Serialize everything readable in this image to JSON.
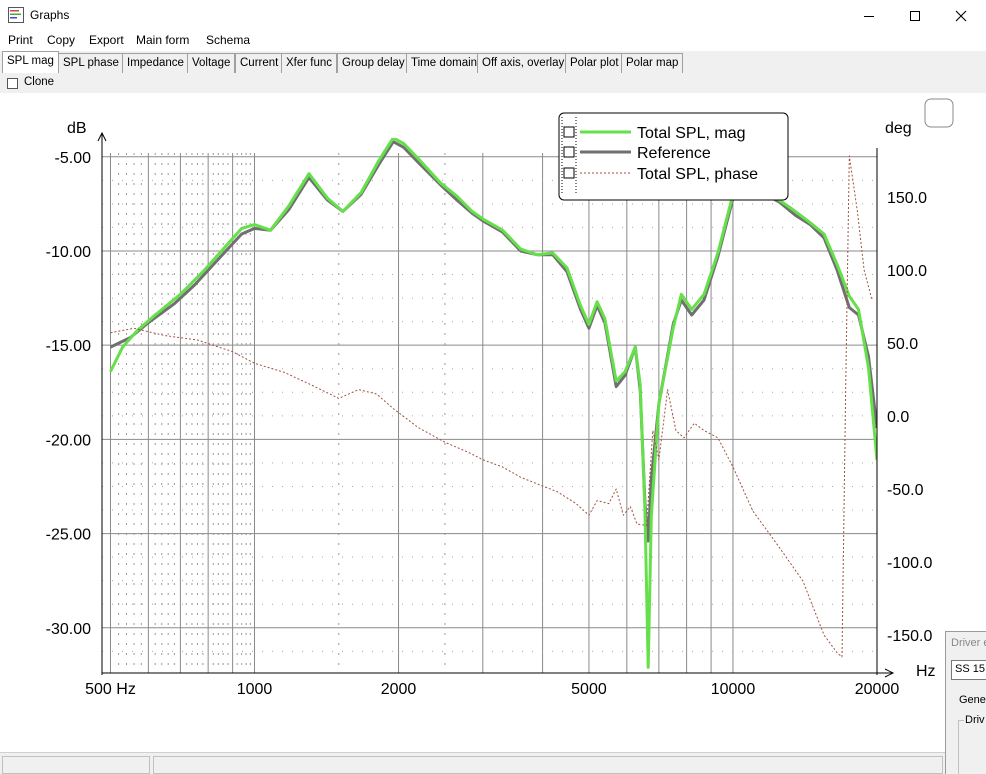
{
  "window": {
    "title": "Graphs"
  },
  "menu": [
    "Print",
    "Copy",
    "Export",
    "Main form",
    "Schema"
  ],
  "tabs": [
    "SPL mag",
    "SPL phase",
    "Impedance",
    "Voltage",
    "Current",
    "Xfer func",
    "Group delay",
    "Time domain",
    "Off axis, overlay",
    "Polar plot",
    "Polar map"
  ],
  "active_tab": "SPL mag",
  "options": {
    "clone_label": "Clone",
    "clone_checked": false
  },
  "driver_panel": {
    "title": "Driver e",
    "combo_value": "SS 15",
    "tab_label": "Gene",
    "group_label": "Driv"
  },
  "colors": {
    "total_spl": "#66e04a",
    "reference": "#707070",
    "phase": "#a0523d",
    "grid": "#8a8a8a"
  },
  "chart_data": {
    "type": "line",
    "ylabel": "dB",
    "y2label": "deg",
    "xunit": "Hz",
    "x_scale": "log",
    "xlim": [
      480,
      20000
    ],
    "ylim": [
      -32.4,
      -4.8
    ],
    "y2lim": [
      -176,
      180
    ],
    "x_ticks": [
      {
        "value": 500,
        "label": "500 Hz"
      },
      {
        "value": 1000,
        "label": "1000"
      },
      {
        "value": 2000,
        "label": "2000"
      },
      {
        "value": 5000,
        "label": "5000"
      },
      {
        "value": 10000,
        "label": "10000"
      },
      {
        "value": 20000,
        "label": "20000"
      }
    ],
    "x_gridlines": [
      500,
      600,
      700,
      800,
      900,
      1000,
      2000,
      3000,
      4000,
      5000,
      6000,
      7000,
      8000,
      9000,
      10000,
      20000
    ],
    "y_ticks": [
      {
        "value": -5,
        "label": "-5.00"
      },
      {
        "value": -10,
        "label": "-10.00"
      },
      {
        "value": -15,
        "label": "-15.00"
      },
      {
        "value": -20,
        "label": "-20.00"
      },
      {
        "value": -25,
        "label": "-25.00"
      },
      {
        "value": -30,
        "label": "-30.00"
      }
    ],
    "y2_ticks": [
      {
        "value": 150,
        "label": "150.0"
      },
      {
        "value": 100,
        "label": "100.0"
      },
      {
        "value": 50,
        "label": "50.0"
      },
      {
        "value": 0,
        "label": "0.0"
      },
      {
        "value": -50,
        "label": "-50.0"
      },
      {
        "value": -100,
        "label": "-100.0"
      },
      {
        "value": -150,
        "label": "-150.0"
      }
    ],
    "grid": true,
    "legend_position": "top-right",
    "series": [
      {
        "name": "Total SPL, mag",
        "axis": "left",
        "style": "solid-thick",
        "color": "#66e04a",
        "points": [
          [
            500,
            -16.4
          ],
          [
            530,
            -15.1
          ],
          [
            570,
            -14.2
          ],
          [
            620,
            -13.4
          ],
          [
            700,
            -12.3
          ],
          [
            780,
            -11.1
          ],
          [
            860,
            -9.9
          ],
          [
            940,
            -8.8
          ],
          [
            1000,
            -8.6
          ],
          [
            1080,
            -8.9
          ],
          [
            1180,
            -7.6
          ],
          [
            1300,
            -5.9
          ],
          [
            1420,
            -7.2
          ],
          [
            1530,
            -7.9
          ],
          [
            1670,
            -6.9
          ],
          [
            1820,
            -5.2
          ],
          [
            1950,
            -4.0
          ],
          [
            2050,
            -4.3
          ],
          [
            2200,
            -5.1
          ],
          [
            2450,
            -6.4
          ],
          [
            2650,
            -7.1
          ],
          [
            2850,
            -7.9
          ],
          [
            3000,
            -8.3
          ],
          [
            3300,
            -8.9
          ],
          [
            3600,
            -9.9
          ],
          [
            3900,
            -10.2
          ],
          [
            4200,
            -10.1
          ],
          [
            4500,
            -10.9
          ],
          [
            4800,
            -12.9
          ],
          [
            5000,
            -13.9
          ],
          [
            5200,
            -12.7
          ],
          [
            5400,
            -13.6
          ],
          [
            5700,
            -16.9
          ],
          [
            5950,
            -16.4
          ],
          [
            6250,
            -15.1
          ],
          [
            6400,
            -17.1
          ],
          [
            6550,
            -23.9
          ],
          [
            6650,
            -32.1
          ],
          [
            6750,
            -24.1
          ],
          [
            7000,
            -18.1
          ],
          [
            7500,
            -14.1
          ],
          [
            7800,
            -12.3
          ],
          [
            8200,
            -13.1
          ],
          [
            8700,
            -12.3
          ],
          [
            9300,
            -10.1
          ],
          [
            10000,
            -7.0
          ],
          [
            10800,
            -7.1
          ],
          [
            11500,
            -6.8
          ],
          [
            12500,
            -7.3
          ],
          [
            13500,
            -7.9
          ],
          [
            14500,
            -8.5
          ],
          [
            15500,
            -9.1
          ],
          [
            16500,
            -10.7
          ],
          [
            17500,
            -12.4
          ],
          [
            18300,
            -13.1
          ],
          [
            19200,
            -16.2
          ],
          [
            20000,
            -21.1
          ]
        ]
      },
      {
        "name": "Reference",
        "axis": "left",
        "style": "solid-thick",
        "color": "#707070",
        "points": [
          [
            500,
            -15.1
          ],
          [
            550,
            -14.6
          ],
          [
            600,
            -13.8
          ],
          [
            680,
            -12.8
          ],
          [
            750,
            -11.8
          ],
          [
            850,
            -10.3
          ],
          [
            940,
            -9.1
          ],
          [
            1000,
            -8.8
          ],
          [
            1080,
            -8.9
          ],
          [
            1180,
            -7.8
          ],
          [
            1300,
            -6.1
          ],
          [
            1420,
            -7.3
          ],
          [
            1530,
            -7.9
          ],
          [
            1670,
            -7.0
          ],
          [
            1820,
            -5.4
          ],
          [
            1950,
            -4.2
          ],
          [
            2050,
            -4.5
          ],
          [
            2200,
            -5.3
          ],
          [
            2450,
            -6.5
          ],
          [
            2650,
            -7.3
          ],
          [
            2850,
            -8.0
          ],
          [
            3000,
            -8.4
          ],
          [
            3300,
            -9.0
          ],
          [
            3600,
            -10.0
          ],
          [
            3900,
            -10.2
          ],
          [
            4200,
            -10.2
          ],
          [
            4500,
            -11.1
          ],
          [
            4800,
            -13.1
          ],
          [
            5000,
            -14.1
          ],
          [
            5200,
            -12.9
          ],
          [
            5400,
            -13.8
          ],
          [
            5700,
            -17.2
          ],
          [
            5950,
            -16.6
          ],
          [
            6250,
            -15.1
          ],
          [
            6400,
            -17.4
          ],
          [
            6550,
            -23.4
          ],
          [
            6650,
            -25.4
          ],
          [
            6750,
            -22.1
          ],
          [
            7000,
            -18.1
          ],
          [
            7500,
            -13.9
          ],
          [
            7800,
            -12.6
          ],
          [
            8200,
            -13.4
          ],
          [
            8700,
            -12.6
          ],
          [
            9300,
            -10.3
          ],
          [
            10000,
            -7.2
          ],
          [
            10800,
            -7.2
          ],
          [
            11500,
            -6.9
          ],
          [
            12500,
            -7.4
          ],
          [
            13500,
            -8.1
          ],
          [
            14500,
            -8.6
          ],
          [
            15500,
            -9.3
          ],
          [
            16500,
            -11.0
          ],
          [
            17500,
            -13.0
          ],
          [
            18300,
            -13.4
          ],
          [
            19200,
            -15.6
          ],
          [
            20000,
            -19.4
          ]
        ]
      },
      {
        "name": "Total SPL, phase",
        "axis": "right",
        "style": "dotted",
        "color": "#a0523d",
        "points": [
          [
            500,
            57
          ],
          [
            560,
            60
          ],
          [
            650,
            55
          ],
          [
            760,
            52
          ],
          [
            900,
            44
          ],
          [
            1000,
            36
          ],
          [
            1150,
            30
          ],
          [
            1300,
            22
          ],
          [
            1500,
            12
          ],
          [
            1650,
            18
          ],
          [
            1800,
            15
          ],
          [
            1950,
            5
          ],
          [
            2200,
            -8
          ],
          [
            2500,
            -18
          ],
          [
            2800,
            -25
          ],
          [
            3000,
            -30
          ],
          [
            3300,
            -35
          ],
          [
            3600,
            -42
          ],
          [
            4000,
            -48
          ],
          [
            4300,
            -52
          ],
          [
            4700,
            -60
          ],
          [
            5000,
            -68
          ],
          [
            5200,
            -58
          ],
          [
            5500,
            -60
          ],
          [
            5700,
            -50
          ],
          [
            5900,
            -68
          ],
          [
            6100,
            -62
          ],
          [
            6300,
            -74
          ],
          [
            6600,
            -75
          ],
          [
            6800,
            -10
          ],
          [
            7000,
            -30
          ],
          [
            7300,
            18
          ],
          [
            7600,
            -10
          ],
          [
            7900,
            -15
          ],
          [
            8300,
            -5
          ],
          [
            8700,
            -10
          ],
          [
            9300,
            -15
          ],
          [
            10000,
            -35
          ],
          [
            11000,
            -65
          ],
          [
            12500,
            -90
          ],
          [
            14000,
            -113
          ],
          [
            15500,
            -150
          ],
          [
            16500,
            -162
          ],
          [
            16900,
            -165
          ],
          [
            17200,
            20
          ],
          [
            17500,
            178
          ],
          [
            18200,
            140
          ],
          [
            18800,
            100
          ],
          [
            19500,
            80
          ]
        ]
      }
    ]
  }
}
